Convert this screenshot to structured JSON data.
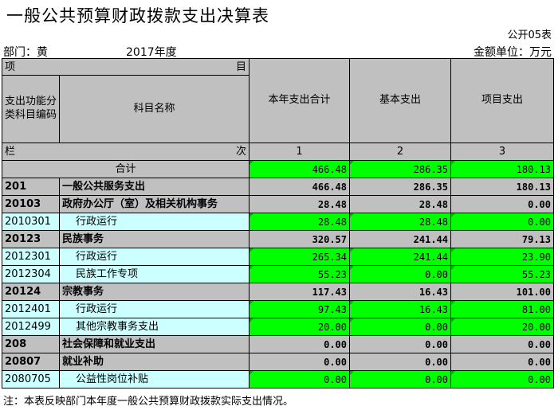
{
  "title": "一般公共预算财政拨款支出决算表",
  "form_no": "公开05表",
  "dept_label": "部门：黄",
  "year": "2017年度",
  "unit": "金额单位：万元",
  "header": {
    "item_left": "项",
    "item_right": "目",
    "func_code": "支出功能分类科目编码",
    "subject_name": "科目名称",
    "col_total": "本年支出合计",
    "col_basic": "基本支出",
    "col_project": "项目支出",
    "lan": "栏",
    "ci": "次",
    "idx1": "1",
    "idx2": "2",
    "idx3": "3"
  },
  "total_row": {
    "label": "合计",
    "v1": "466.48",
    "v2": "286.35",
    "v3": "180.13"
  },
  "rows": [
    {
      "code": "201",
      "name": "一般公共服务支出",
      "v1": "466.48",
      "v2": "286.35",
      "v3": "180.13"
    },
    {
      "code": "20103",
      "name": "政府办公厅（室）及相关机构事务",
      "v1": "28.48",
      "v2": "28.48",
      "v3": "0.00"
    },
    {
      "code": "2010301",
      "name": "行政运行",
      "v1": "28.48",
      "v2": "28.48",
      "v3": "0.00"
    },
    {
      "code": "20123",
      "name": "民族事务",
      "v1": "320.57",
      "v2": "241.44",
      "v3": "79.13"
    },
    {
      "code": "2012301",
      "name": "行政运行",
      "v1": "265.34",
      "v2": "241.44",
      "v3": "23.90"
    },
    {
      "code": "2012304",
      "name": "民族工作专项",
      "v1": "55.23",
      "v2": "0.00",
      "v3": "55.23"
    },
    {
      "code": "20124",
      "name": "宗教事务",
      "v1": "117.43",
      "v2": "16.43",
      "v3": "101.00"
    },
    {
      "code": "2012401",
      "name": "行政运行",
      "v1": "97.43",
      "v2": "16.43",
      "v3": "81.00"
    },
    {
      "code": "2012499",
      "name": "其他宗教事务支出",
      "v1": "20.00",
      "v2": "0.00",
      "v3": "20.00"
    },
    {
      "code": "208",
      "name": "社会保障和就业支出",
      "v1": "0.00",
      "v2": "0.00",
      "v3": "0.00"
    },
    {
      "code": "20807",
      "name": "就业补助",
      "v1": "0.00",
      "v2": "0.00",
      "v3": "0.00"
    },
    {
      "code": "2080705",
      "name": "公益性岗位补贴",
      "v1": "0.00",
      "v2": "0.00",
      "v3": "0.00"
    }
  ],
  "note": "注：本表反映部门本年度一般公共预算财政拨款实际支出情况。"
}
